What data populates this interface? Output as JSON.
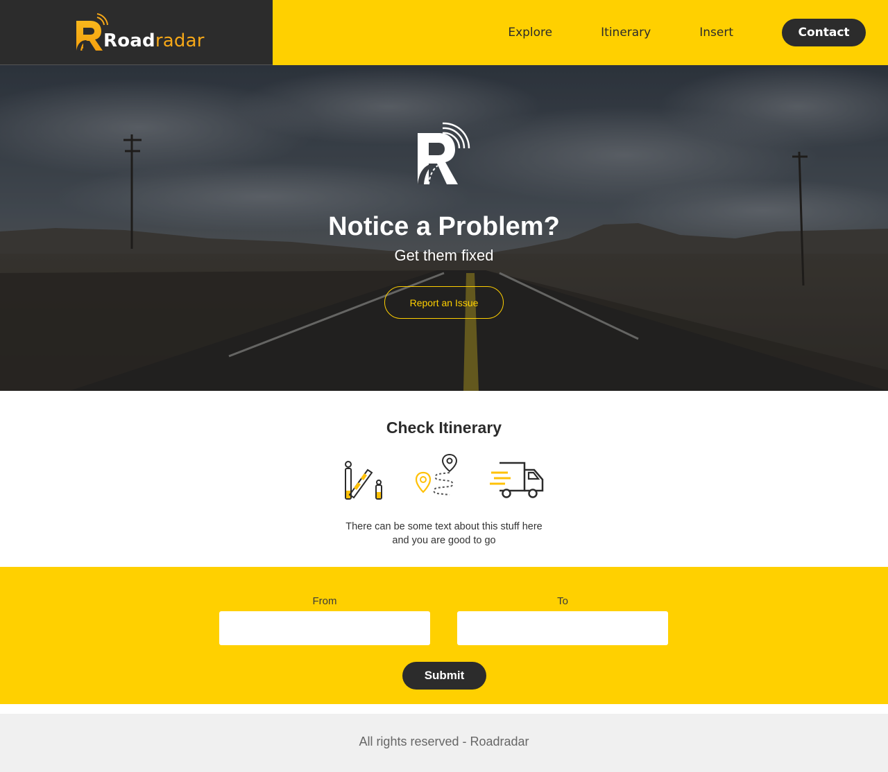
{
  "header": {
    "brand_bold": "Road",
    "brand_light": "radar",
    "nav": [
      "Explore",
      "Itinerary",
      "Insert"
    ],
    "contact_label": "Contact"
  },
  "hero": {
    "title": "Notice a Problem?",
    "subtitle": "Get them fixed",
    "cta_label": "Report an Issue"
  },
  "itinerary": {
    "title": "Check Itinerary",
    "icons": [
      "barrier-gate-icon",
      "route-map-icon",
      "delivery-truck-icon"
    ],
    "text_line1": "There can be some text about this stuff here",
    "text_line2": "and you are good to go"
  },
  "form": {
    "from_label": "From",
    "to_label": "To",
    "from_value": "",
    "to_value": "",
    "submit_label": "Submit"
  },
  "footer": {
    "text": "All rights reserved - Roadradar"
  },
  "colors": {
    "accent": "#ffd000",
    "dark": "#2c2c2c",
    "brand_orange": "#f6a818",
    "footer_bg": "#f0f0f0"
  }
}
